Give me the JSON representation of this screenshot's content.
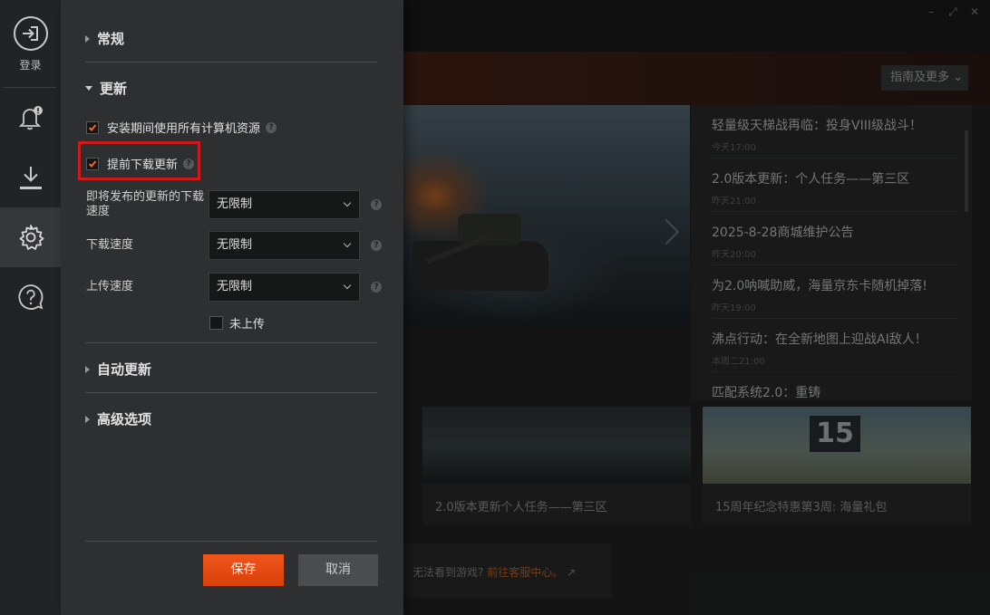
{
  "window": {
    "controls": [
      "–",
      "⤢",
      "✕"
    ]
  },
  "rail": {
    "login_label": "登录"
  },
  "settings": {
    "sections": {
      "general": "常规",
      "update": "更新",
      "auto_update": "自动更新",
      "advanced": "高级选项"
    },
    "options": {
      "use_all_resources": "安装期间使用所有计算机资源",
      "predownload": "提前下载更新",
      "upcoming_speed_label_1": "即将发布的更新的下载",
      "upcoming_speed_label_2": "速度",
      "download_speed_label": "下载速度",
      "upload_speed_label": "上传速度",
      "upcoming_speed_value": "无限制",
      "download_speed_value": "无限制",
      "upload_speed_value": "无限制",
      "not_uploading": "未上传",
      "help_glyph": "?"
    },
    "buttons": {
      "save": "保存",
      "cancel": "取消"
    }
  },
  "background": {
    "guide_button": "指南及更多 ⌄",
    "news": [
      {
        "title": "轻量级天梯战再临：投身VIII级战斗！",
        "time": "今天17:00"
      },
      {
        "title": "2.0版本更新：个人任务——第三区",
        "time": "昨天21:00"
      },
      {
        "title": "2025-8-28商城维护公告",
        "time": "昨天20:00"
      },
      {
        "title": "为2.0呐喊助威，海量京东卡随机掉落!",
        "time": "昨天19:00"
      },
      {
        "title": "沸点行动：在全新地图上迎战AI敌人！",
        "time": "本周二21:00"
      },
      {
        "title": "匹配系统2.0：重铸",
        "time": ""
      }
    ],
    "cards": [
      {
        "title": "2.0版本更新个人任务——第三区"
      },
      {
        "title": "15周年纪念特惠第3周: 海量礼包",
        "badge": "15"
      }
    ],
    "support": {
      "question": "无法看到游戏?",
      "link": "前往客服中心。"
    }
  },
  "colors": {
    "accent": "#e8511a",
    "highlight": "#d01a1a",
    "panel": "#2e2f30"
  }
}
